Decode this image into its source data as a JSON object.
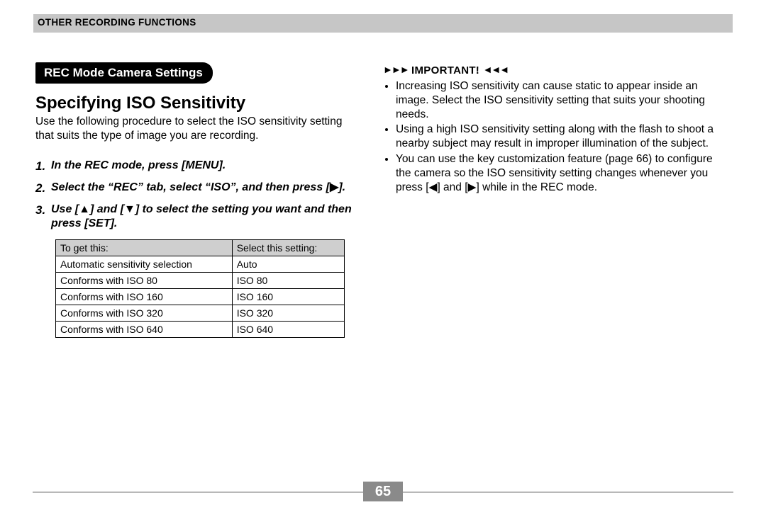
{
  "banner": "OTHER RECORDING FUNCTIONS",
  "section_pill": "REC Mode Camera Settings",
  "heading": "Specifying ISO Sensitivity",
  "intro": "Use the following procedure to select the ISO sensitivity setting that suits the type of image you are recording.",
  "steps": [
    {
      "num": "1.",
      "text": "In the REC mode, press [MENU]."
    },
    {
      "num": "2.",
      "text_pre": "Select the “REC” tab, select “ISO”, and then press [",
      "glyph": "▶",
      "text_post": "]."
    },
    {
      "num": "3.",
      "text_pre": "Use [",
      "glyph1": "▲",
      "mid1": "] and [",
      "glyph2": "▼",
      "mid2": "] to select the setting you want and then press [SET]."
    }
  ],
  "table": {
    "head": [
      "To get this:",
      "Select this setting:"
    ],
    "rows": [
      [
        "Automatic sensitivity selection",
        "Auto"
      ],
      [
        "Conforms with ISO 80",
        "ISO 80"
      ],
      [
        "Conforms with ISO 160",
        "ISO 160"
      ],
      [
        "Conforms with ISO 320",
        "ISO 320"
      ],
      [
        "Conforms with ISO 640",
        "ISO 640"
      ]
    ]
  },
  "important": {
    "label": "IMPORTANT!",
    "bullets": [
      "Increasing ISO sensitivity can cause static to appear inside an image. Select the ISO sensitivity setting that suits your shooting needs.",
      "Using a high ISO sensitivity setting along with the flash to shoot a nearby subject may result in improper illumination of the subject.",
      {
        "pre": "You can use the key customization feature (page 66) to configure the camera so the ISO sensitivity setting changes whenever you press [",
        "g1": "◀",
        "mid": "] and [",
        "g2": "▶",
        "post": "] while in the REC mode."
      }
    ]
  },
  "page_number": "65"
}
